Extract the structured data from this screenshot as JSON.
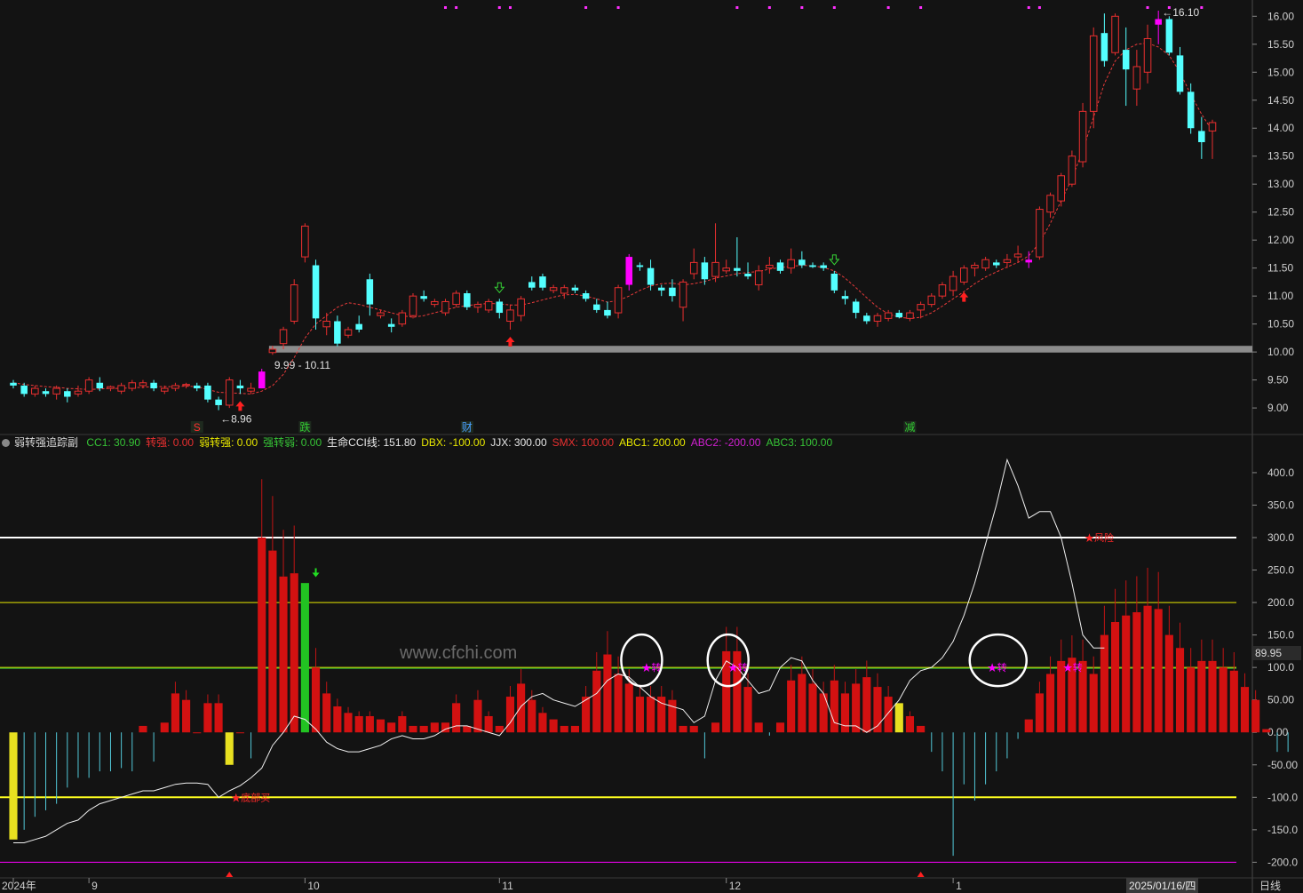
{
  "chart_data": [
    {
      "type": "candlestick",
      "price_axis": {
        "ylim": [
          8.7,
          16.1
        ],
        "ticks": [
          9.0,
          9.5,
          10.0,
          10.5,
          11.0,
          11.5,
          12.0,
          12.5,
          13.0,
          13.5,
          14.0,
          14.5,
          15.0,
          15.5,
          16.0
        ],
        "tick_labels": [
          "9.00",
          "9.50",
          "10.00",
          "10.50",
          "11.00",
          "11.50",
          "12.00",
          "12.50",
          "13.00",
          "13.50",
          "14.00",
          "14.50",
          "15.00",
          "15.50",
          "16.00"
        ]
      },
      "ohlc": [
        [
          9.45,
          9.5,
          9.35,
          9.4
        ],
        [
          9.4,
          9.45,
          9.2,
          9.25
        ],
        [
          9.25,
          9.4,
          9.2,
          9.35
        ],
        [
          9.3,
          9.35,
          9.2,
          9.25
        ],
        [
          9.25,
          9.4,
          9.15,
          9.35
        ],
        [
          9.3,
          9.35,
          9.1,
          9.2
        ],
        [
          9.25,
          9.4,
          9.2,
          9.3
        ],
        [
          9.3,
          9.55,
          9.25,
          9.5
        ],
        [
          9.45,
          9.55,
          9.3,
          9.35
        ],
        [
          9.35,
          9.4,
          9.3,
          9.38
        ],
        [
          9.3,
          9.45,
          9.25,
          9.4
        ],
        [
          9.35,
          9.5,
          9.3,
          9.45
        ],
        [
          9.4,
          9.5,
          9.35,
          9.45
        ],
        [
          9.45,
          9.5,
          9.3,
          9.35
        ],
        [
          9.3,
          9.4,
          9.25,
          9.35
        ],
        [
          9.35,
          9.45,
          9.3,
          9.4
        ],
        [
          9.4,
          9.45,
          9.35,
          9.42
        ],
        [
          9.4,
          9.45,
          9.3,
          9.35
        ],
        [
          9.4,
          9.45,
          9.1,
          9.15
        ],
        [
          9.15,
          9.2,
          8.96,
          9.05
        ],
        [
          9.05,
          9.55,
          9.0,
          9.5
        ],
        [
          9.4,
          9.5,
          9.25,
          9.35
        ],
        [
          9.3,
          9.45,
          9.25,
          9.35
        ],
        [
          9.35,
          9.7,
          9.35,
          9.65
        ],
        [
          9.99,
          10.11,
          9.95,
          10.05
        ],
        [
          10.15,
          10.45,
          10.05,
          10.4
        ],
        [
          10.55,
          11.3,
          10.5,
          11.2
        ],
        [
          11.7,
          12.3,
          11.6,
          12.25
        ],
        [
          11.55,
          11.65,
          10.4,
          10.6
        ],
        [
          10.45,
          10.7,
          10.3,
          10.55
        ],
        [
          10.55,
          10.65,
          10.1,
          10.15
        ],
        [
          10.3,
          10.45,
          10.25,
          10.4
        ],
        [
          10.5,
          10.65,
          10.35,
          10.4
        ],
        [
          11.3,
          11.4,
          10.65,
          10.85
        ],
        [
          10.65,
          10.75,
          10.6,
          10.7
        ],
        [
          10.5,
          10.6,
          10.35,
          10.45
        ],
        [
          10.5,
          10.75,
          10.45,
          10.7
        ],
        [
          10.65,
          11.05,
          10.6,
          11.0
        ],
        [
          11.0,
          11.1,
          10.9,
          10.95
        ],
        [
          10.85,
          10.95,
          10.8,
          10.9
        ],
        [
          10.7,
          10.95,
          10.65,
          10.9
        ],
        [
          10.85,
          11.1,
          10.8,
          11.05
        ],
        [
          11.05,
          11.1,
          10.75,
          10.8
        ],
        [
          10.8,
          10.9,
          10.7,
          10.85
        ],
        [
          10.75,
          10.95,
          10.7,
          10.9
        ],
        [
          10.9,
          10.95,
          10.6,
          10.7
        ],
        [
          10.55,
          10.85,
          10.4,
          10.75
        ],
        [
          10.65,
          11.0,
          10.55,
          10.95
        ],
        [
          11.25,
          11.35,
          11.1,
          11.15
        ],
        [
          11.35,
          11.4,
          11.1,
          11.15
        ],
        [
          11.1,
          11.2,
          11.05,
          11.15
        ],
        [
          11.05,
          11.2,
          10.95,
          11.15
        ],
        [
          11.15,
          11.2,
          11.05,
          11.1
        ],
        [
          11.05,
          11.1,
          10.9,
          10.95
        ],
        [
          10.85,
          10.95,
          10.7,
          10.75
        ],
        [
          10.75,
          10.9,
          10.6,
          10.65
        ],
        [
          10.7,
          11.2,
          10.6,
          11.15
        ],
        [
          11.2,
          11.75,
          11.1,
          11.7
        ],
        [
          11.55,
          11.6,
          11.45,
          11.52
        ],
        [
          11.5,
          11.65,
          11.1,
          11.2
        ],
        [
          11.15,
          11.2,
          11.0,
          11.1
        ],
        [
          11.15,
          11.3,
          10.9,
          11.0
        ],
        [
          10.8,
          11.3,
          10.55,
          11.25
        ],
        [
          11.4,
          11.85,
          11.3,
          11.6
        ],
        [
          11.6,
          11.7,
          11.2,
          11.3
        ],
        [
          11.35,
          12.3,
          11.25,
          11.6
        ],
        [
          11.45,
          11.65,
          11.4,
          11.5
        ],
        [
          11.5,
          12.05,
          11.35,
          11.45
        ],
        [
          11.4,
          11.6,
          11.3,
          11.35
        ],
        [
          11.2,
          11.55,
          11.1,
          11.45
        ],
        [
          11.5,
          11.7,
          11.4,
          11.55
        ],
        [
          11.6,
          11.65,
          11.4,
          11.45
        ],
        [
          11.5,
          11.85,
          11.4,
          11.65
        ],
        [
          11.65,
          11.8,
          11.5,
          11.55
        ],
        [
          11.55,
          11.6,
          11.5,
          11.52
        ],
        [
          11.55,
          11.6,
          11.45,
          11.5
        ],
        [
          11.4,
          11.45,
          11.05,
          11.1
        ],
        [
          11.0,
          11.1,
          10.85,
          10.95
        ],
        [
          10.9,
          10.95,
          10.6,
          10.7
        ],
        [
          10.65,
          10.7,
          10.5,
          10.55
        ],
        [
          10.55,
          10.7,
          10.45,
          10.65
        ],
        [
          10.6,
          10.75,
          10.55,
          10.7
        ],
        [
          10.7,
          10.75,
          10.6,
          10.62
        ],
        [
          10.6,
          10.75,
          10.55,
          10.7
        ],
        [
          10.75,
          10.9,
          10.6,
          10.85
        ],
        [
          10.85,
          11.05,
          10.8,
          11.0
        ],
        [
          11.0,
          11.25,
          10.95,
          11.2
        ],
        [
          11.1,
          11.45,
          11.0,
          11.35
        ],
        [
          11.25,
          11.55,
          11.2,
          11.5
        ],
        [
          11.5,
          11.6,
          11.35,
          11.55
        ],
        [
          11.5,
          11.7,
          11.45,
          11.65
        ],
        [
          11.6,
          11.65,
          11.5,
          11.55
        ],
        [
          11.6,
          11.75,
          11.5,
          11.65
        ],
        [
          11.7,
          11.9,
          11.6,
          11.75
        ],
        [
          11.65,
          11.8,
          11.5,
          11.6
        ],
        [
          11.7,
          12.6,
          11.65,
          12.55
        ],
        [
          12.5,
          12.85,
          12.4,
          12.8
        ],
        [
          12.7,
          13.2,
          12.6,
          13.15
        ],
        [
          13.0,
          13.6,
          12.95,
          13.5
        ],
        [
          13.4,
          14.45,
          13.3,
          14.3
        ],
        [
          14.3,
          15.8,
          14.0,
          15.65
        ],
        [
          15.7,
          16.05,
          15.1,
          15.2
        ],
        [
          15.35,
          16.05,
          15.3,
          16.0
        ],
        [
          15.4,
          15.8,
          14.4,
          15.05
        ],
        [
          14.7,
          15.4,
          14.4,
          15.1
        ],
        [
          15.0,
          15.85,
          14.8,
          15.6
        ],
        [
          15.85,
          16.1,
          15.5,
          15.95
        ],
        [
          15.95,
          16.0,
          15.3,
          15.35
        ],
        [
          15.3,
          15.45,
          14.6,
          14.65
        ],
        [
          14.65,
          14.8,
          13.9,
          14.0
        ],
        [
          13.95,
          14.2,
          13.45,
          13.75
        ],
        [
          13.95,
          14.15,
          13.45,
          14.1
        ]
      ],
      "bar_colors_override": {
        "up_fill": "#ff00ff",
        "indices": [
          23,
          57,
          94,
          106
        ]
      },
      "ma_line": [
        9.45,
        9.42,
        9.4,
        9.38,
        9.37,
        9.35,
        9.34,
        9.33,
        9.34,
        9.35,
        9.35,
        9.36,
        9.37,
        9.38,
        9.38,
        9.38,
        9.39,
        9.38,
        9.33,
        9.28,
        9.27,
        9.26,
        9.25,
        9.3,
        9.4,
        9.6,
        9.9,
        10.25,
        10.5,
        10.65,
        10.8,
        10.88,
        10.85,
        10.8,
        10.75,
        10.7,
        10.65,
        10.62,
        10.65,
        10.7,
        10.75,
        10.8,
        10.83,
        10.85,
        10.87,
        10.86,
        10.84,
        10.84,
        10.88,
        10.93,
        10.98,
        11.02,
        11.03,
        11.0,
        10.95,
        10.89,
        10.92,
        11.0,
        11.1,
        11.18,
        11.22,
        11.23,
        11.2,
        11.22,
        11.26,
        11.32,
        11.36,
        11.4,
        11.42,
        11.44,
        11.48,
        11.51,
        11.53,
        11.55,
        11.54,
        11.51,
        11.45,
        11.32,
        11.15,
        10.97,
        10.8,
        10.68,
        10.62,
        10.6,
        10.62,
        10.7,
        10.82,
        10.95,
        11.08,
        11.22,
        11.34,
        11.43,
        11.52,
        11.6,
        11.72,
        11.95,
        12.3,
        12.7,
        13.1,
        13.6,
        14.2,
        14.8,
        15.2,
        15.4,
        15.5,
        15.52,
        15.45,
        15.3,
        15.0,
        14.6,
        14.25,
        13.95
      ],
      "hline": {
        "y_range": [
          9.99,
          10.11
        ],
        "label": "9.99 - 10.11"
      },
      "high_label": "16.10",
      "low_label": "8.96",
      "top_dots_x_index": [
        40,
        41,
        45,
        46,
        53,
        56,
        67,
        70,
        73,
        76,
        81,
        84,
        94,
        95,
        105,
        107,
        110
      ],
      "up_arrows_index": [
        21,
        46,
        88
      ],
      "down_arrows_index": [
        45,
        76
      ],
      "event_tags": [
        {
          "index": 17,
          "text": "S",
          "color": "#ff3030"
        },
        {
          "index": 27,
          "text": "跌",
          "color": "#31c831"
        },
        {
          "index": 42,
          "text": "财",
          "color": "#4aa0ff"
        },
        {
          "index": 83,
          "text": "减",
          "color": "#31c831"
        }
      ]
    },
    {
      "type": "indicator",
      "title": "弱转强追踪副",
      "ylim": [
        -220,
        430
      ],
      "ticks": [
        -200,
        -150,
        -100,
        -50,
        0,
        50,
        100,
        150,
        200,
        250,
        300,
        350,
        400
      ],
      "tick_labels": [
        "-200.0",
        "-150.0",
        "-100.0",
        "-50.00",
        "0.00",
        "50.00",
        "100.0",
        "150.0",
        "200.0",
        "250.0",
        "300.0",
        "350.0",
        "400.0"
      ],
      "hlines": [
        {
          "y": 300,
          "color": "#ffffff"
        },
        {
          "y": 200,
          "color": "#e8e800"
        },
        {
          "y": 100,
          "color": "#e8e800"
        },
        {
          "y": -100,
          "color": "#ffff20"
        },
        {
          "y": -200,
          "color": "#ff00ff"
        }
      ],
      "legend": [
        {
          "text": "CC1: 30.90",
          "color": "#36c336"
        },
        {
          "text": "转强: 0.00",
          "color": "#e83030"
        },
        {
          "text": "弱转强: 0.00",
          "color": "#e8e800"
        },
        {
          "text": "强转弱: 0.00",
          "color": "#36c336"
        },
        {
          "text": "生命CCI线: 151.80",
          "color": "#e8e8e8"
        },
        {
          "text": "DBX: -100.00",
          "color": "#e8e800"
        },
        {
          "text": "JJX: 300.00",
          "color": "#e8e8e8"
        },
        {
          "text": "SMX: 100.00",
          "color": "#e83030"
        },
        {
          "text": "ABC1: 200.00",
          "color": "#e8e800"
        },
        {
          "text": "ABC2: -200.00",
          "color": "#d020d0"
        },
        {
          "text": "ABC3: 100.00",
          "color": "#36c336"
        }
      ],
      "bars": [
        -165,
        -150,
        -130,
        -120,
        -110,
        -85,
        -70,
        -70,
        -60,
        -60,
        -55,
        -60,
        10,
        -45,
        15,
        60,
        50,
        0,
        45,
        45,
        -50,
        0,
        -40,
        300,
        280,
        240,
        245,
        230,
        100,
        60,
        40,
        30,
        25,
        25,
        20,
        15,
        25,
        10,
        10,
        15,
        15,
        45,
        10,
        50,
        25,
        10,
        55,
        75,
        50,
        30,
        20,
        10,
        10,
        55,
        95,
        120,
        90,
        75,
        55,
        55,
        55,
        50,
        10,
        10,
        -40,
        15,
        125,
        125,
        70,
        15,
        -5,
        15,
        80,
        90,
        75,
        60,
        80,
        60,
        75,
        85,
        70,
        55,
        45,
        25,
        10,
        -30,
        -60,
        -190,
        -80,
        -105,
        -80,
        -60,
        -40,
        -10,
        20,
        60,
        90,
        110,
        115,
        110,
        90,
        150,
        170,
        180,
        185,
        195,
        190,
        150,
        130,
        100,
        110,
        110,
        100,
        95,
        70,
        50,
        5,
        -30,
        -30
      ],
      "bar_fill_colors": {
        "positive": "#d31111",
        "negative_line": "#52c8d8",
        "special": {
          "yellow": [
            0,
            20,
            82
          ],
          "green": [
            27
          ]
        }
      },
      "cci_line": [
        -170,
        -170,
        -165,
        -160,
        -150,
        -140,
        -135,
        -120,
        -110,
        -105,
        -100,
        -95,
        -90,
        -90,
        -85,
        -80,
        -78,
        -78,
        -80,
        -100,
        -90,
        -82,
        -70,
        -55,
        -20,
        0,
        25,
        20,
        5,
        -15,
        -25,
        -30,
        -30,
        -25,
        -20,
        -10,
        -5,
        -10,
        -10,
        -5,
        5,
        10,
        10,
        5,
        0,
        -5,
        15,
        40,
        55,
        60,
        50,
        45,
        40,
        50,
        60,
        80,
        90,
        85,
        70,
        55,
        45,
        40,
        35,
        15,
        25,
        80,
        110,
        100,
        80,
        60,
        65,
        100,
        115,
        110,
        80,
        60,
        15,
        10,
        10,
        0,
        10,
        30,
        50,
        80,
        95,
        100,
        115,
        140,
        180,
        230,
        290,
        350,
        420,
        380,
        330,
        340,
        340,
        300,
        230,
        150,
        130,
        130
      ],
      "annotations": [
        {
          "index": 20,
          "value": -100,
          "text": "★底部买",
          "color": "#ff2828"
        },
        {
          "index": 58,
          "value": 100,
          "text": "★转",
          "color": "#ff00ff"
        },
        {
          "index": 66,
          "value": 100,
          "text": "★转",
          "color": "#ff00ff"
        },
        {
          "index": 90,
          "value": 100,
          "text": "★转",
          "color": "#ff00ff"
        },
        {
          "index": 97,
          "value": 100,
          "text": "★转",
          "color": "#ff00ff"
        },
        {
          "index": 99,
          "value": 300,
          "text": "★风险",
          "color": "#ff2828"
        }
      ],
      "circle_index": [
        58,
        66,
        91
      ],
      "green_arrow_index": 28,
      "last_value_box": "89.95"
    }
  ],
  "x_axis": {
    "labels": [
      {
        "index": 0,
        "text": "2024年"
      },
      {
        "index": 7,
        "text": "9"
      },
      {
        "index": 27,
        "text": "10"
      },
      {
        "index": 45,
        "text": "11"
      },
      {
        "index": 66,
        "text": "12"
      },
      {
        "index": 87,
        "text": "1"
      }
    ],
    "cursor_date": "2025/01/16/四",
    "period": "日线"
  },
  "watermark": "www.cfchi.com",
  "colors": {
    "up": "#ea2f2f",
    "down": "#54ffff",
    "bg": "#131313",
    "ma": "#e83a3a"
  }
}
